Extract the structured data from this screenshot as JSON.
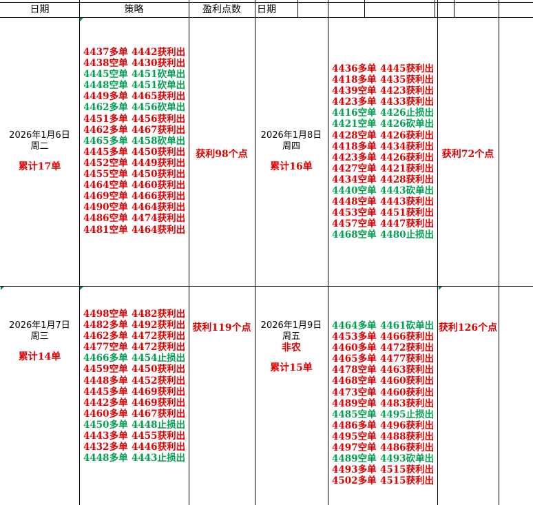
{
  "headers": {
    "date1": "日期",
    "strategy": "策略",
    "profit_points": "盈利点数",
    "date2": "日期"
  },
  "colors": {
    "red": "#e00000",
    "green": "#00a050"
  },
  "blocks": {
    "mon": {
      "date": "2026年1月6日",
      "weekday": "周二",
      "total": "累计17单",
      "profit": "获利98个点",
      "trades": [
        {
          "entry": "4437多单",
          "exit": "4442获利出",
          "color": "red"
        },
        {
          "entry": "4438空单",
          "exit": "4430获利出",
          "color": "red"
        },
        {
          "entry": "4445空单",
          "exit": "4451砍单出",
          "color": "green"
        },
        {
          "entry": "4448空单",
          "exit": "4451砍单出",
          "color": "green"
        },
        {
          "entry": "4449多单",
          "exit": "4465获利出",
          "color": "red"
        },
        {
          "entry": "4462多单",
          "exit": "4456砍单出",
          "color": "green"
        },
        {
          "entry": "4451多单",
          "exit": "4456获利出",
          "color": "red"
        },
        {
          "entry": "4462多单",
          "exit": "4467获利出",
          "color": "red"
        },
        {
          "entry": "4465多单",
          "exit": "4458砍单出",
          "color": "green"
        },
        {
          "entry": "4445多单",
          "exit": "4450获利出",
          "color": "red"
        },
        {
          "entry": "4452空单",
          "exit": "4449获利出",
          "color": "red"
        },
        {
          "entry": "4455空单",
          "exit": "4450获利出",
          "color": "red"
        },
        {
          "entry": "4464空单",
          "exit": "4460获利出",
          "color": "red"
        },
        {
          "entry": "4469空单",
          "exit": "4466获利出",
          "color": "red"
        },
        {
          "entry": "4490空单",
          "exit": "4464获利出",
          "color": "red"
        },
        {
          "entry": "4486空单",
          "exit": "4474获利出",
          "color": "red"
        },
        {
          "entry": "4481空单",
          "exit": "4464获利出",
          "color": "red"
        }
      ]
    },
    "thu": {
      "date": "2026年1月8日",
      "weekday": "周四",
      "total": "累计16单",
      "profit": "获利72个点",
      "trades": [
        {
          "entry": "4436多单",
          "exit": "4445获利出",
          "color": "red"
        },
        {
          "entry": "4418多单",
          "exit": "4435获利出",
          "color": "red"
        },
        {
          "entry": "4439空单",
          "exit": "4423获利出",
          "color": "red"
        },
        {
          "entry": "4423多单",
          "exit": "4433获利出",
          "color": "red"
        },
        {
          "entry": "4416空单",
          "exit": "4426止损出",
          "color": "green"
        },
        {
          "entry": "4421空单",
          "exit": "4426砍单出",
          "color": "green"
        },
        {
          "entry": "4428空单",
          "exit": "4426获利出",
          "color": "red"
        },
        {
          "entry": "4418多单",
          "exit": "4434获利出",
          "color": "red"
        },
        {
          "entry": "4423多单",
          "exit": "4426获利出",
          "color": "red"
        },
        {
          "entry": "4427空单",
          "exit": "4421获利出",
          "color": "red"
        },
        {
          "entry": "4434空单",
          "exit": "4428获利出",
          "color": "red"
        },
        {
          "entry": "4440空单",
          "exit": "4443砍单出",
          "color": "green"
        },
        {
          "entry": "4448空单",
          "exit": "4443获利出",
          "color": "red"
        },
        {
          "entry": "4453空单",
          "exit": "4451获利出",
          "color": "red"
        },
        {
          "entry": "4457空单",
          "exit": "4447获利出",
          "color": "red"
        },
        {
          "entry": "4468空单",
          "exit": "4480止损出",
          "color": "green"
        }
      ]
    },
    "wed": {
      "date": "2026年1月7日",
      "weekday": "周三",
      "total": "累计14单",
      "profit": "获利119个点",
      "trades": [
        {
          "entry": "4498空单",
          "exit": "4482获利出",
          "color": "red"
        },
        {
          "entry": "4482多单",
          "exit": "4492获利出",
          "color": "red"
        },
        {
          "entry": "4462多单",
          "exit": "4472获利出",
          "color": "red"
        },
        {
          "entry": "4477空单",
          "exit": "4472获利出",
          "color": "red"
        },
        {
          "entry": "4466多单",
          "exit": "4454止损出",
          "color": "green"
        },
        {
          "entry": "4459空单",
          "exit": "4450获利出",
          "color": "red"
        },
        {
          "entry": "4448多单",
          "exit": "4452获利出",
          "color": "red"
        },
        {
          "entry": "4445多单",
          "exit": "4469获利出",
          "color": "red"
        },
        {
          "entry": "4442多单",
          "exit": "4469获利出",
          "color": "red"
        },
        {
          "entry": "4460多单",
          "exit": "4467获利出",
          "color": "red"
        },
        {
          "entry": "4450多单",
          "exit": "4448止损出",
          "color": "green"
        },
        {
          "entry": "4443多单",
          "exit": "4455获利出",
          "color": "red"
        },
        {
          "entry": "4432多单",
          "exit": "4446获利出",
          "color": "red"
        },
        {
          "entry": "4448多单",
          "exit": "4443止损出",
          "color": "green"
        }
      ]
    },
    "fri": {
      "date": "2026年1月9日",
      "weekday": "周五",
      "note": "非农",
      "total": "累计15单",
      "profit": "获利126个点",
      "trades": [
        {
          "entry": "4464多单",
          "exit": "4461砍单出",
          "color": "green"
        },
        {
          "entry": "4453多单",
          "exit": "4466获利出",
          "color": "red"
        },
        {
          "entry": "4460多单",
          "exit": "4472获利出",
          "color": "red"
        },
        {
          "entry": "4465多单",
          "exit": "4477获利出",
          "color": "red"
        },
        {
          "entry": "4478空单",
          "exit": "4463获利出",
          "color": "red"
        },
        {
          "entry": "4468空单",
          "exit": "4460获利出",
          "color": "red"
        },
        {
          "entry": "4473空单",
          "exit": "4460获利出",
          "color": "red"
        },
        {
          "entry": "4489空单",
          "exit": "4483获利出",
          "color": "red"
        },
        {
          "entry": "4485空单",
          "exit": "4495止损出",
          "color": "green"
        },
        {
          "entry": "4486多单",
          "exit": "4496获利出",
          "color": "red"
        },
        {
          "entry": "4495空单",
          "exit": "4488获利出",
          "color": "red"
        },
        {
          "entry": "4497空单",
          "exit": "4486获利出",
          "color": "red"
        },
        {
          "entry": "4489空单",
          "exit": "4493砍单出",
          "color": "green"
        },
        {
          "entry": "4493多单",
          "exit": "4515获利出",
          "color": "red"
        },
        {
          "entry": "4502多单",
          "exit": "4515获利出",
          "color": "red"
        }
      ]
    }
  }
}
